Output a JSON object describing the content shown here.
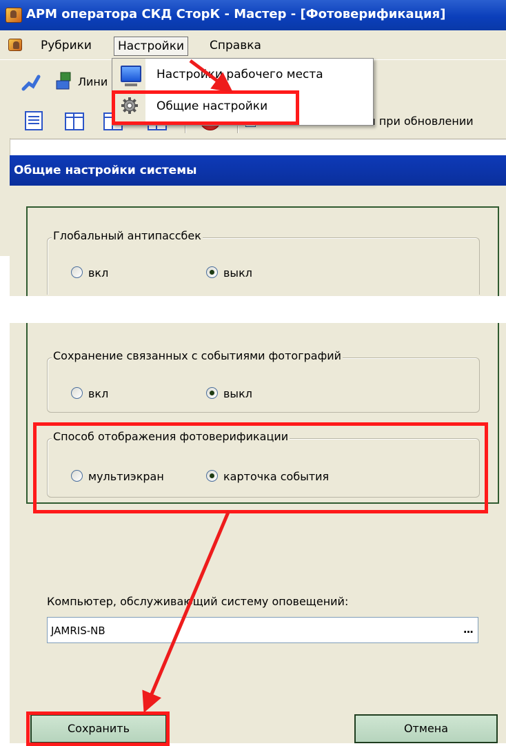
{
  "window": {
    "title": "АРМ оператора СКД СторК - Мастер - [Фотоверификация]",
    "icon": "app-icon"
  },
  "menubar": {
    "items": [
      {
        "label": "Рубрики"
      },
      {
        "label": "Настройки"
      },
      {
        "label": "Справка"
      }
    ]
  },
  "toolbar1": {
    "partial_label": "Лини"
  },
  "toolbar2": {
    "partial_label": "зон при обновлении"
  },
  "dropdown": {
    "items": [
      {
        "label": "Настройки рабочего места",
        "icon": "monitor-icon"
      },
      {
        "label": "Общие настройки",
        "icon": "gear-icon"
      }
    ]
  },
  "dialog": {
    "title": "Общие настройки системы",
    "groups": [
      {
        "title": "Глобальный антипассбек",
        "options": [
          {
            "label": "вкл",
            "selected": false
          },
          {
            "label": "выкл",
            "selected": true
          }
        ]
      },
      {
        "title": "Сохранение связанных с событиями фотографий",
        "options": [
          {
            "label": "вкл",
            "selected": false
          },
          {
            "label": "выкл",
            "selected": true
          }
        ]
      },
      {
        "title": "Способ отображения фотоверификации",
        "options": [
          {
            "label": "мультиэкран",
            "selected": false
          },
          {
            "label": "карточка события",
            "selected": true
          }
        ]
      }
    ],
    "server_label": "Компьютер, обслуживающий систему оповещений:",
    "server_value": "JAMRIS-NB",
    "browse_label": "...",
    "save_label": "Сохранить",
    "cancel_label": "Отмена"
  },
  "colors": {
    "highlight": "#ff1a1a",
    "titlebar": "#0b3fbb",
    "button_face": "#b6d4bd",
    "frame": "#2f5a2f"
  }
}
